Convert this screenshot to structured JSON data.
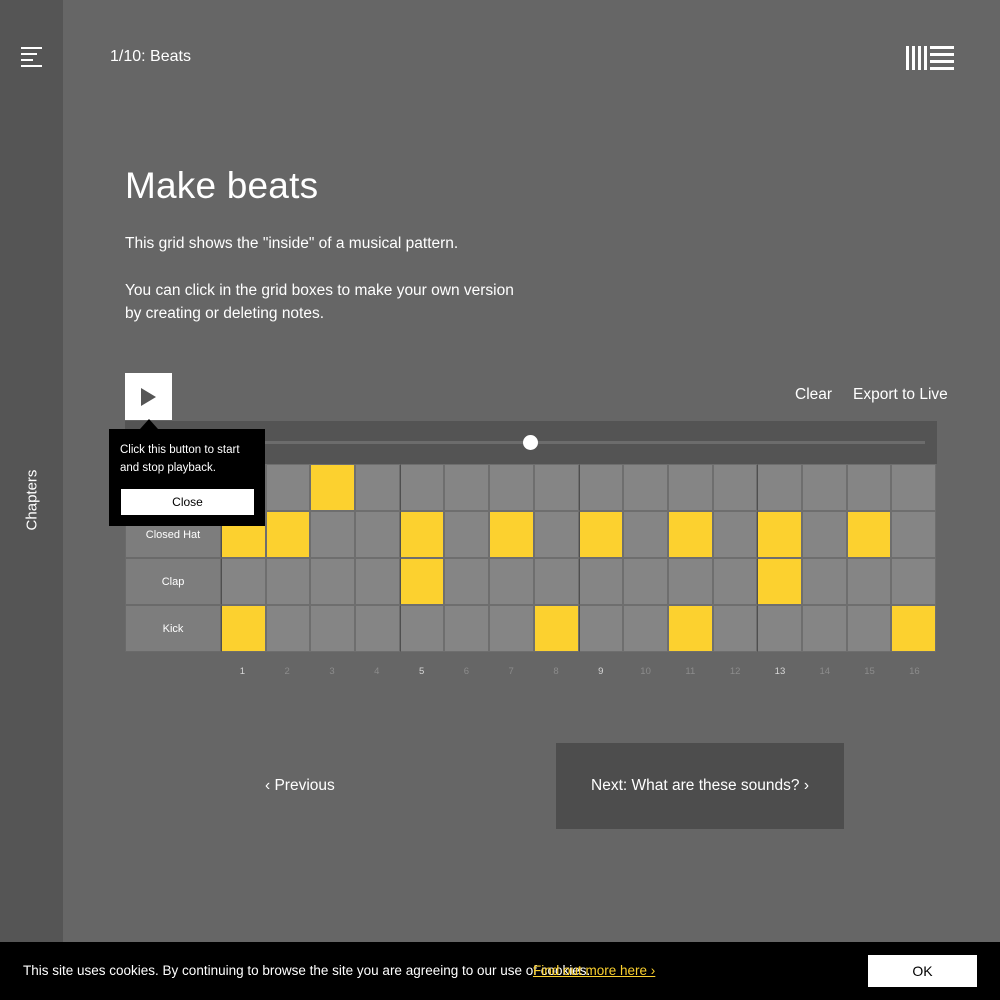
{
  "sidebar": {
    "menu_icon": "hamburger-menu-icon",
    "chapters_label": "Chapters"
  },
  "header": {
    "breadcrumb": "1/10: Beats",
    "logo": "ableton-logo"
  },
  "main": {
    "title": "Make beats",
    "intro_1": "This grid shows the \"inside\" of a musical pattern.",
    "intro_2": "You can click in the grid boxes to make your own version by creating or deleting notes."
  },
  "toolbar": {
    "play_icon": "play-icon",
    "clear_label": "Clear",
    "export_label": "Export to Live",
    "tempo_level": 0.42
  },
  "sequencer": {
    "accent_color": "#fcd12f",
    "rows": [
      {
        "label": "",
        "steps": [
          0,
          0,
          1,
          0,
          0,
          0,
          0,
          0,
          0,
          0,
          0,
          0,
          0,
          0,
          0,
          0
        ]
      },
      {
        "label": "Closed Hat",
        "steps": [
          1,
          1,
          0,
          0,
          1,
          0,
          1,
          0,
          1,
          0,
          1,
          0,
          1,
          0,
          1,
          0
        ]
      },
      {
        "label": "Clap",
        "steps": [
          0,
          0,
          0,
          0,
          1,
          0,
          0,
          0,
          0,
          0,
          0,
          0,
          1,
          0,
          0,
          0
        ]
      },
      {
        "label": "Kick",
        "steps": [
          1,
          0,
          0,
          0,
          0,
          0,
          0,
          1,
          0,
          0,
          1,
          0,
          0,
          0,
          0,
          1
        ]
      }
    ],
    "step_numbers": [
      "1",
      "2",
      "3",
      "4",
      "5",
      "6",
      "7",
      "8",
      "9",
      "10",
      "11",
      "12",
      "13",
      "14",
      "15",
      "16"
    ],
    "accent_steps": [
      "1",
      "5",
      "9",
      "13"
    ]
  },
  "tooltip": {
    "text": "Click this button to start and stop playback.",
    "close_label": "Close"
  },
  "navigation": {
    "previous_label": "‹ Previous",
    "next_label": "Next: What are these sounds? ›"
  },
  "cookie": {
    "text": "This site uses cookies. By continuing to browse the site you are agreeing to our use of cookies.",
    "link_label": "Find out more here ›",
    "ok_label": "OK"
  }
}
